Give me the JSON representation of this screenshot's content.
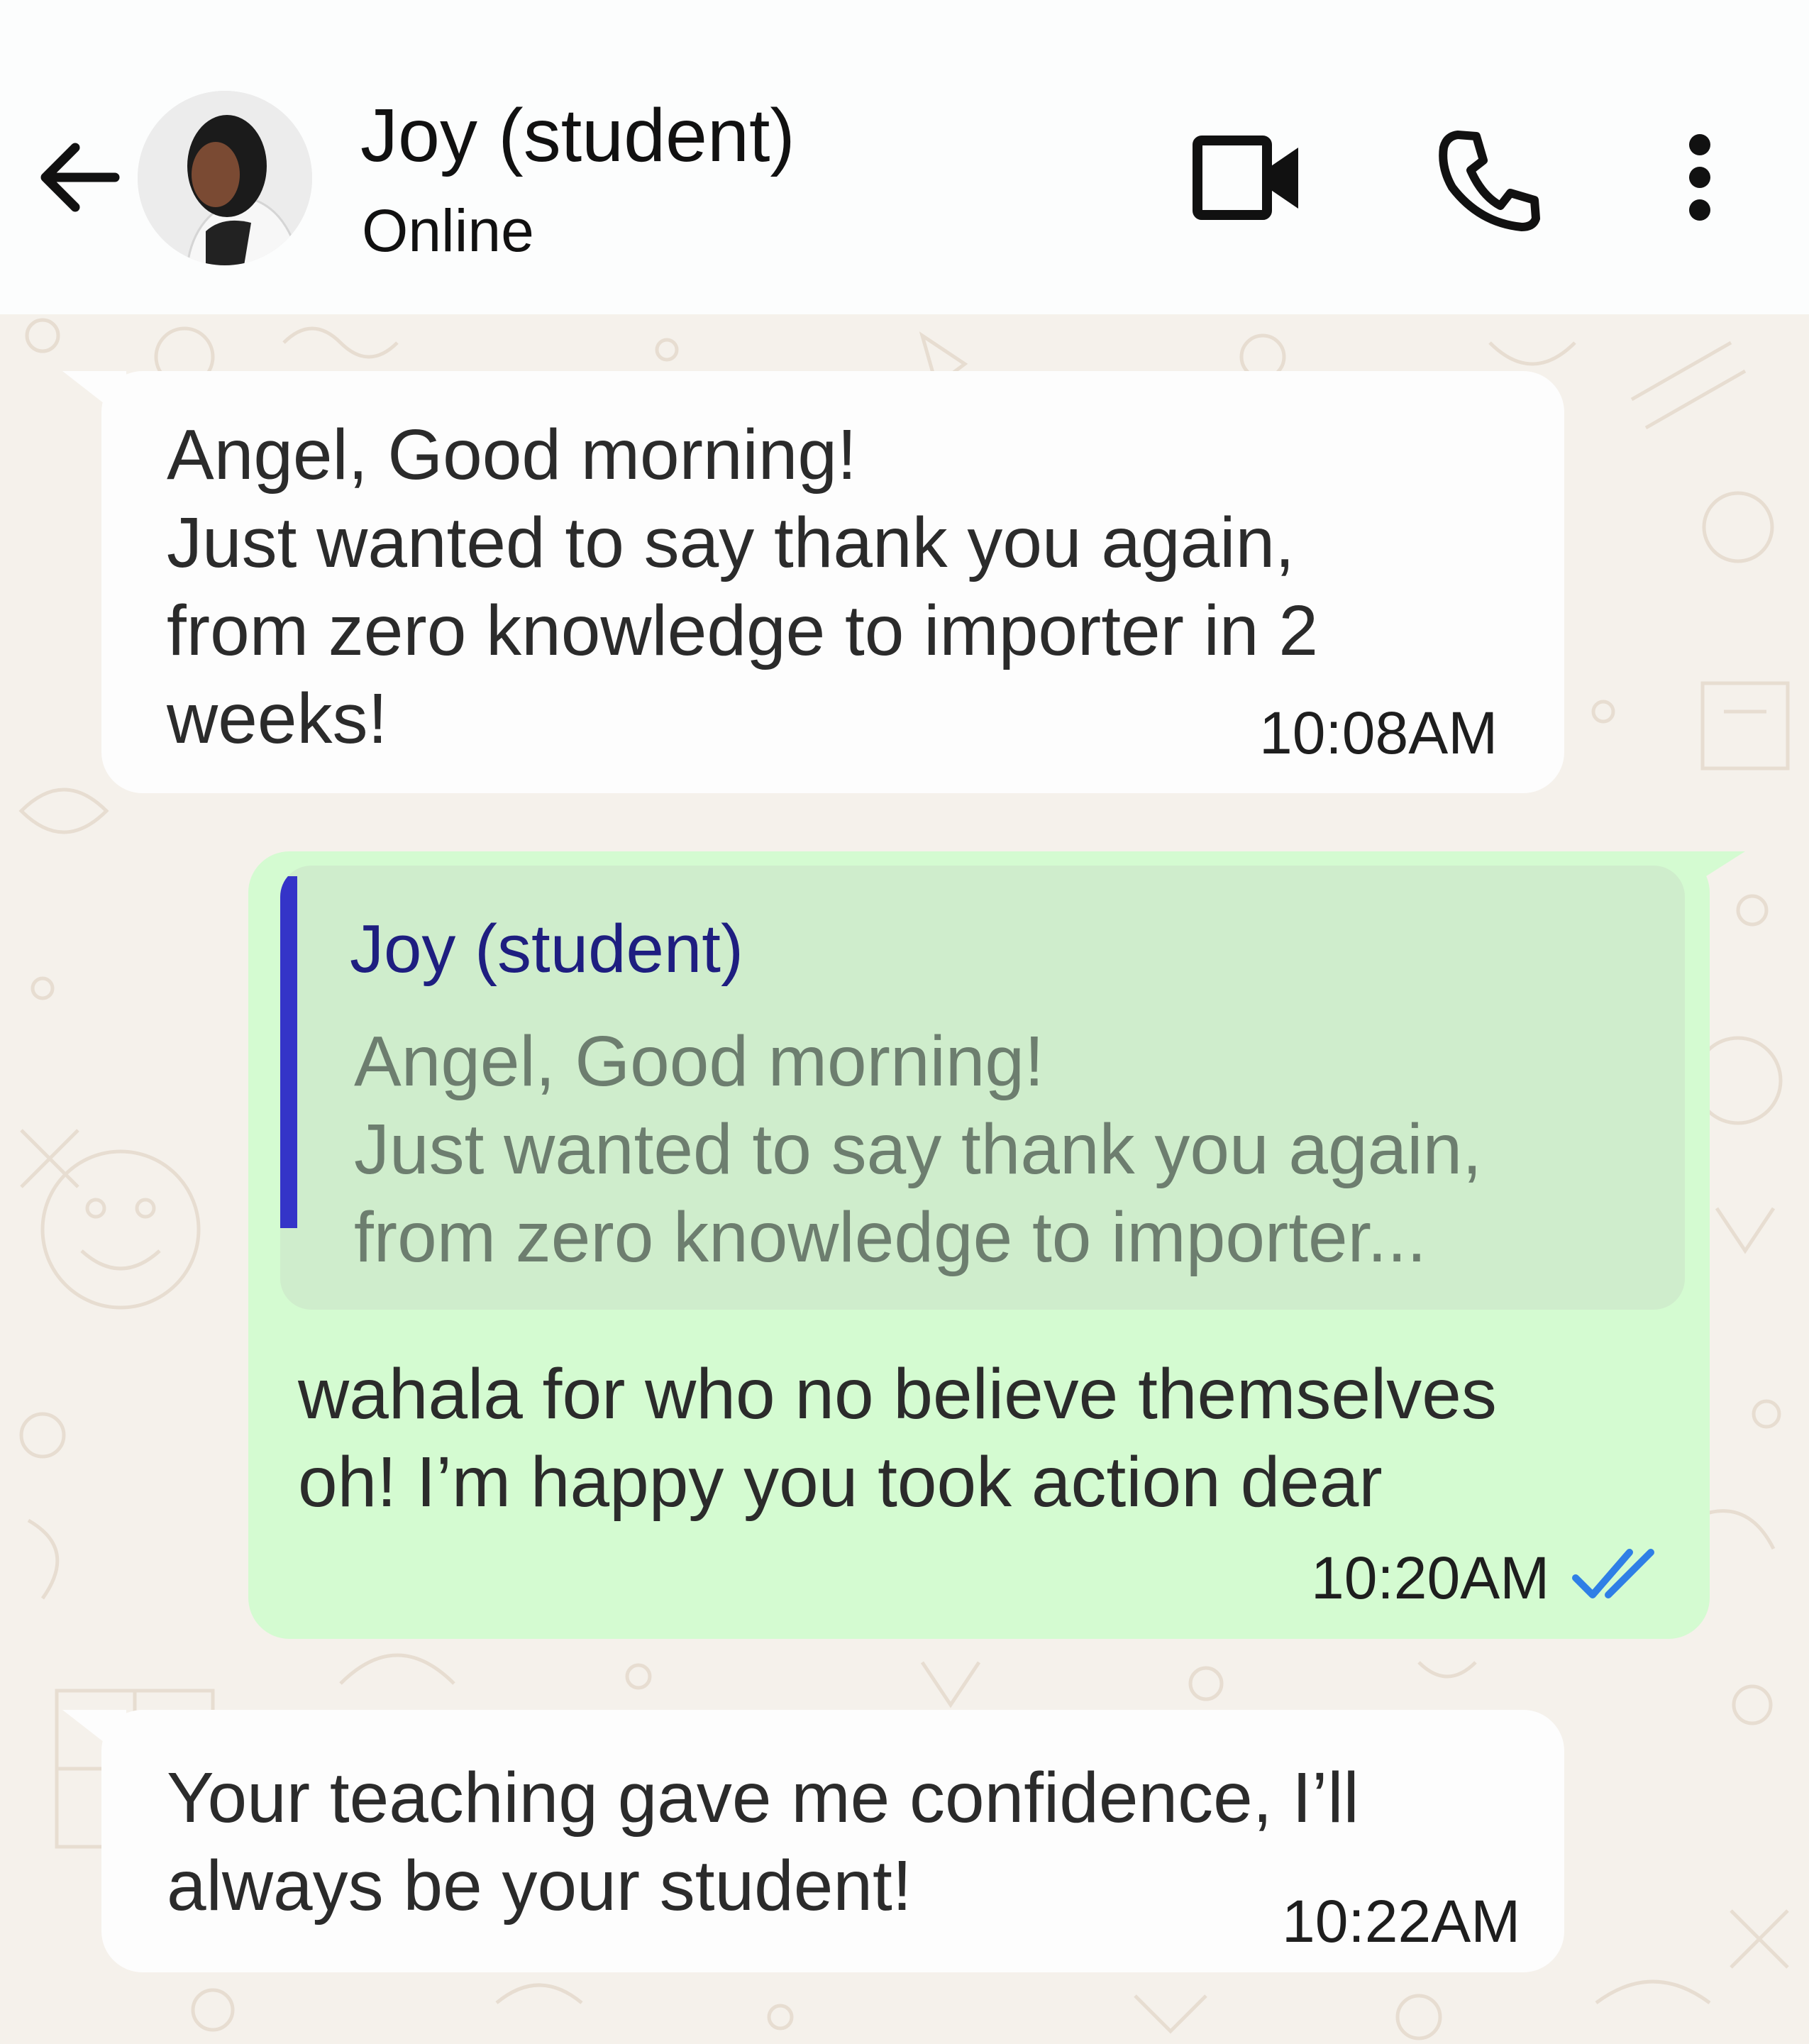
{
  "header": {
    "contact_name": "Joy (student)",
    "status": "Online",
    "icons": {
      "back": "back-arrow-icon",
      "video": "video-camera-icon",
      "call": "phone-icon",
      "menu": "more-vertical-icon"
    }
  },
  "messages": [
    {
      "direction": "incoming",
      "lines": [
        "Angel, Good morning!",
        "Just wanted to say thank you again,",
        "from zero knowledge to importer in 2",
        "weeks!"
      ],
      "time": "10:08AM"
    },
    {
      "direction": "outgoing",
      "quote": {
        "author": "Joy (student)",
        "lines": [
          "Angel, Good morning!",
          "Just wanted to say thank you again,",
          "from zero knowledge to importer..."
        ]
      },
      "lines": [
        "wahala for who no believe themselves",
        "oh! I’m happy you took action dear"
      ],
      "time": "10:20AM",
      "read_status": "read-double-check-icon"
    },
    {
      "direction": "incoming",
      "lines": [
        "Your teaching gave me confidence, I’ll",
        "always be your student!"
      ],
      "time": "10:22AM"
    }
  ],
  "colors": {
    "incoming_bubble": "#fdfdfd",
    "outgoing_bubble": "#d4fbd1",
    "quote_background": "#cfedcc",
    "quote_bar": "#3434c8",
    "quote_author": "#1e1e80",
    "read_ticks": "#2f7fe6",
    "chat_background": "#f5f1eb"
  }
}
